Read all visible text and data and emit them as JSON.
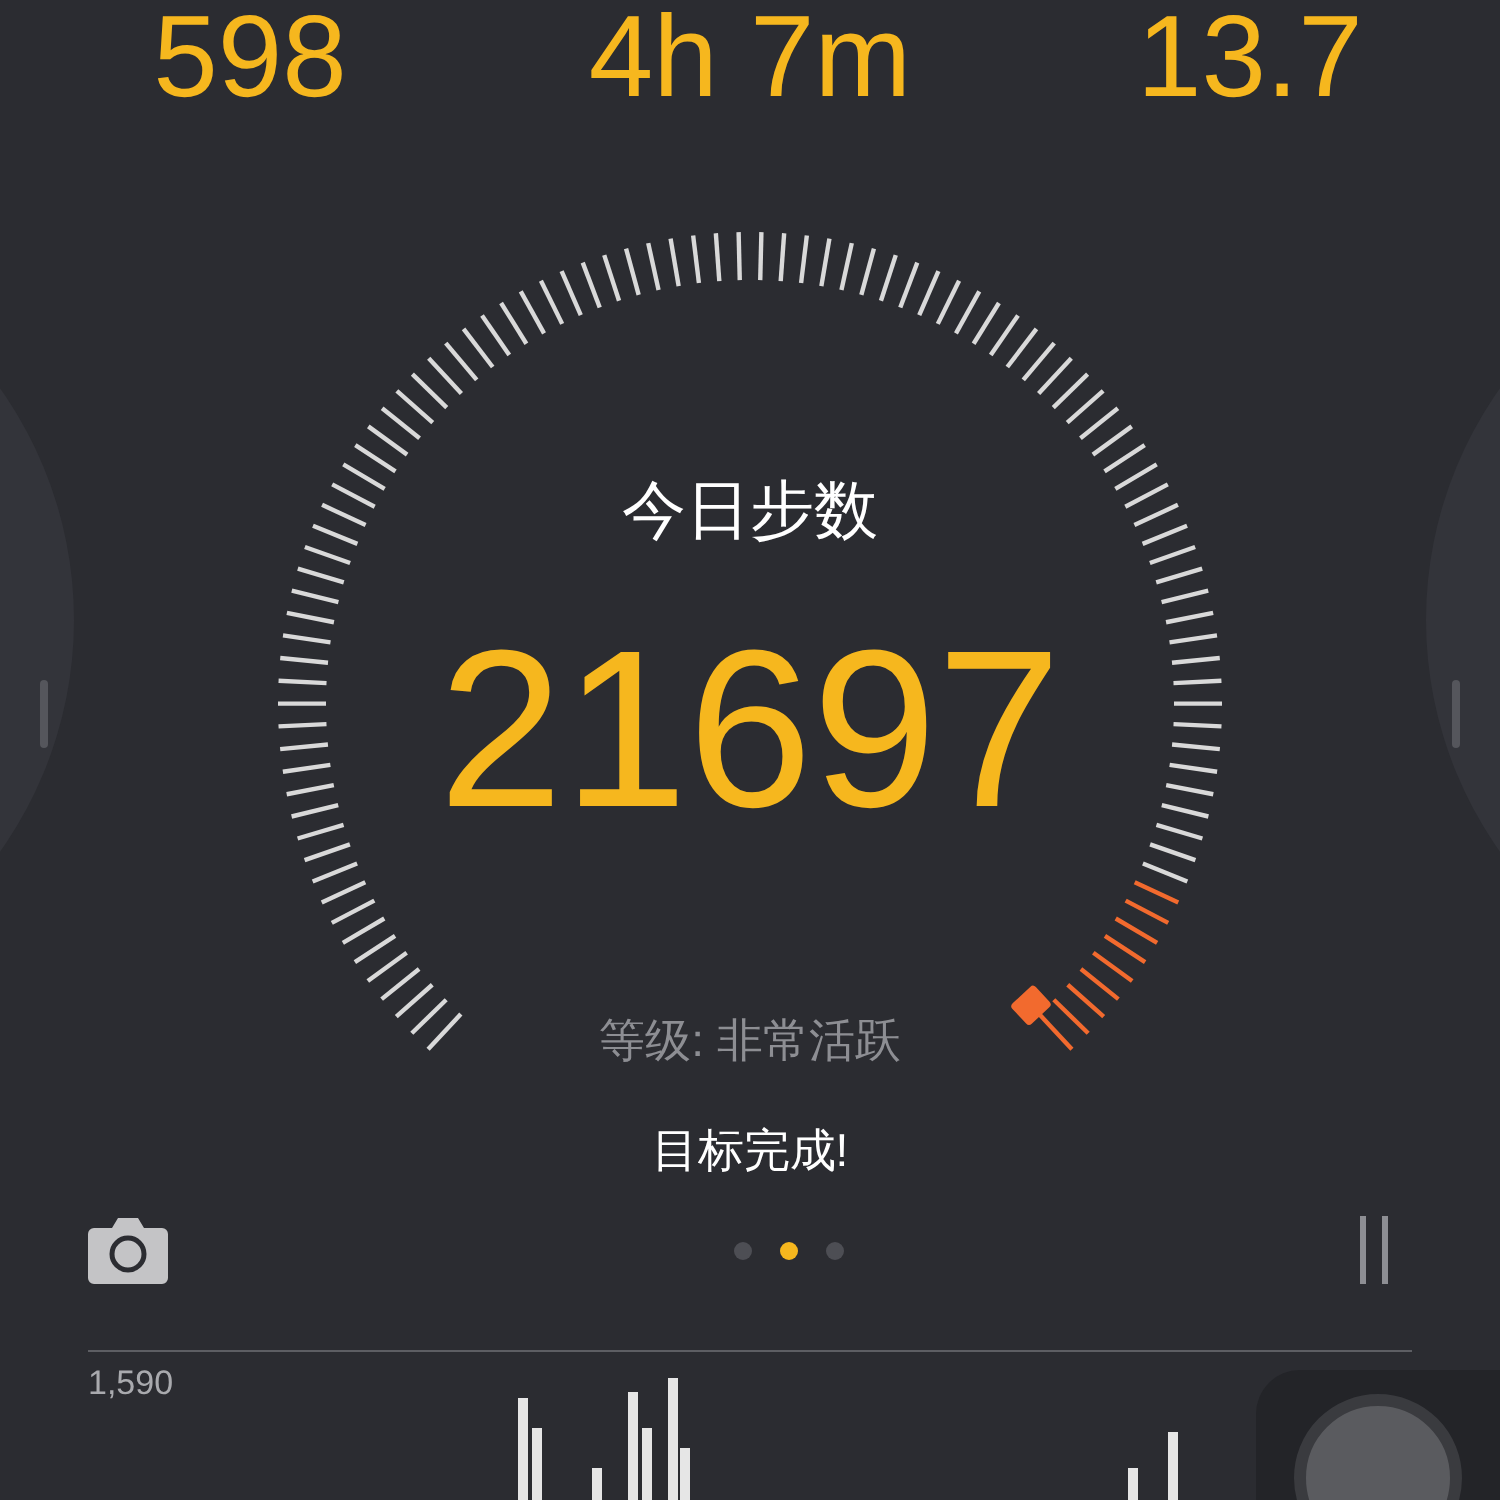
{
  "stats": [
    {
      "value": "598"
    },
    {
      "value": "4h 7m"
    },
    {
      "value": "13.7"
    }
  ],
  "gauge": {
    "title": "今日步数",
    "steps": "21697",
    "grade": "等级: 非常活跃",
    "goal_status": "目标完成!"
  },
  "pager": [
    {
      "selected": false
    },
    {
      "selected": true
    },
    {
      "selected": false
    }
  ],
  "chart": {
    "max_label": "1,590"
  }
}
